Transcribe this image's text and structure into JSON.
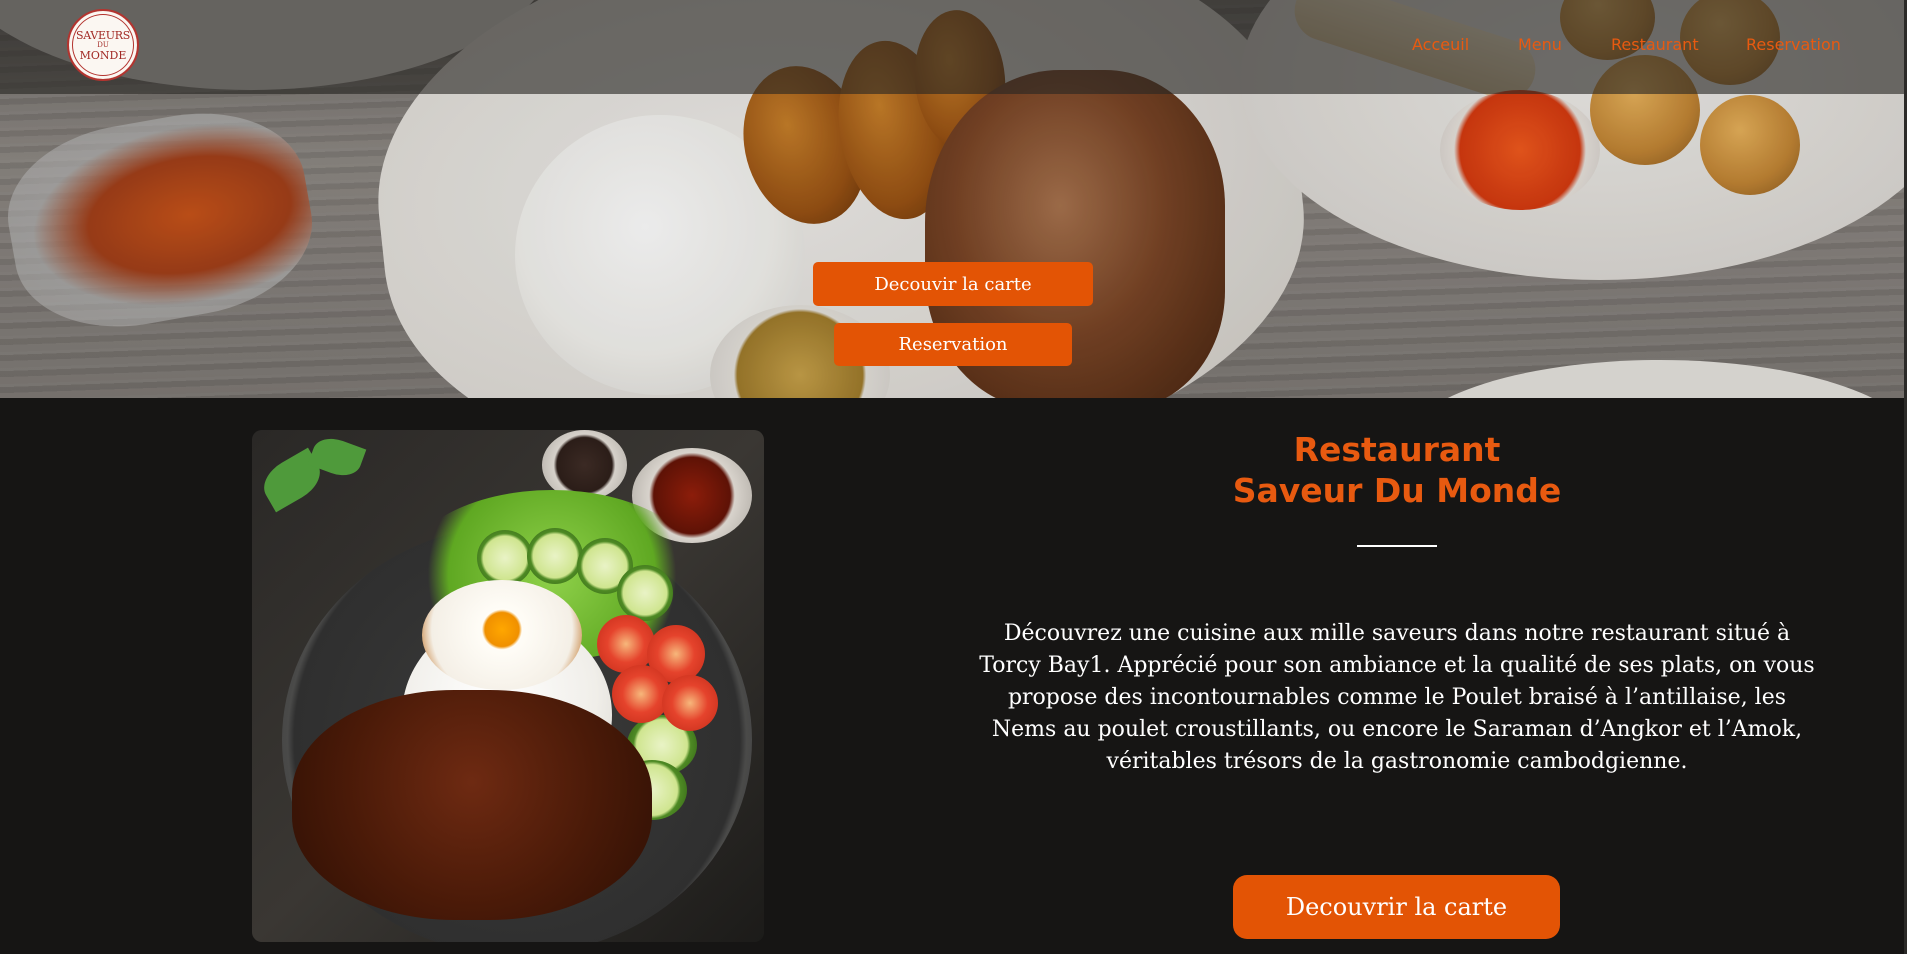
{
  "logo": {
    "line1": "SAVEURS",
    "line2": "DU",
    "line3": "MONDE"
  },
  "nav": {
    "items": [
      {
        "label": "Acceuil"
      },
      {
        "label": "Menu"
      },
      {
        "label": "Restaurant"
      },
      {
        "label": "Reservation"
      }
    ]
  },
  "hero": {
    "menu_button": "Decouvir la carte",
    "reservation_button": "Reservation"
  },
  "about": {
    "title_line1": "Restaurant",
    "title_line2": "Saveur Du Monde",
    "description": "Découvrez une cuisine aux mille saveurs dans notre restaurant situé à Torcy Bay1. Apprécié pour son ambiance et la qualité de ses plats, on vous propose des incontournables comme le Poulet braisé à l’antillaise, les Nems au poulet croustillants, ou encore le Saraman d’Angkor et l’Amok, véritables trésors de la gastronomie cambodgienne.",
    "cta_button": "Decouvrir la carte"
  },
  "colors": {
    "accent": "#e35405",
    "nav_link": "#e85a10",
    "background": "#161514",
    "text": "#ffffff"
  }
}
